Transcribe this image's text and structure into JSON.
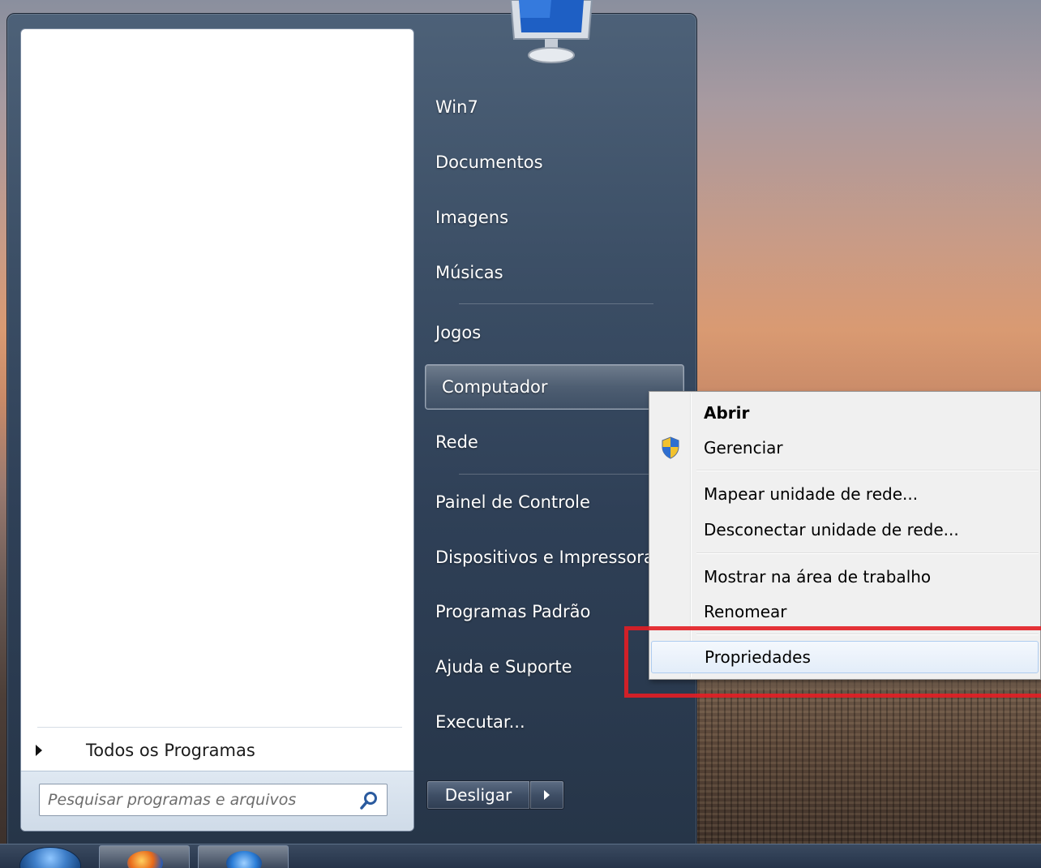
{
  "start_menu": {
    "all_programs_label": "Todos os Programas",
    "search": {
      "placeholder": "Pesquisar programas e arquivos"
    },
    "right_items": [
      {
        "label": "Win7"
      },
      {
        "label": "Documentos"
      },
      {
        "label": "Imagens"
      },
      {
        "label": "Músicas"
      },
      {
        "label": "Jogos"
      },
      {
        "label": "Computador"
      },
      {
        "label": "Rede"
      },
      {
        "label": "Painel de Controle"
      },
      {
        "label": "Dispositivos e Impressoras"
      },
      {
        "label": "Programas Padrão"
      },
      {
        "label": "Ajuda e Suporte"
      },
      {
        "label": "Executar..."
      }
    ],
    "shutdown_label": "Desligar"
  },
  "context_menu": {
    "items": [
      {
        "label": "Abrir"
      },
      {
        "label": "Gerenciar"
      },
      {
        "label": "Mapear unidade de rede..."
      },
      {
        "label": "Desconectar unidade de rede..."
      },
      {
        "label": "Mostrar na área de trabalho"
      },
      {
        "label": "Renomear"
      },
      {
        "label": "Propriedades"
      }
    ]
  },
  "icons": {
    "user_picture": "monitor-icon",
    "search": "search-icon",
    "gerenciar": "uac-shield-icon",
    "shutdown_options": "arrow-right-icon",
    "all_programs": "arrow-right-icon"
  },
  "colors": {
    "highlight": "#e31e24",
    "menu_background": "#f0f0f0",
    "selected_item": "#e3edf9"
  }
}
